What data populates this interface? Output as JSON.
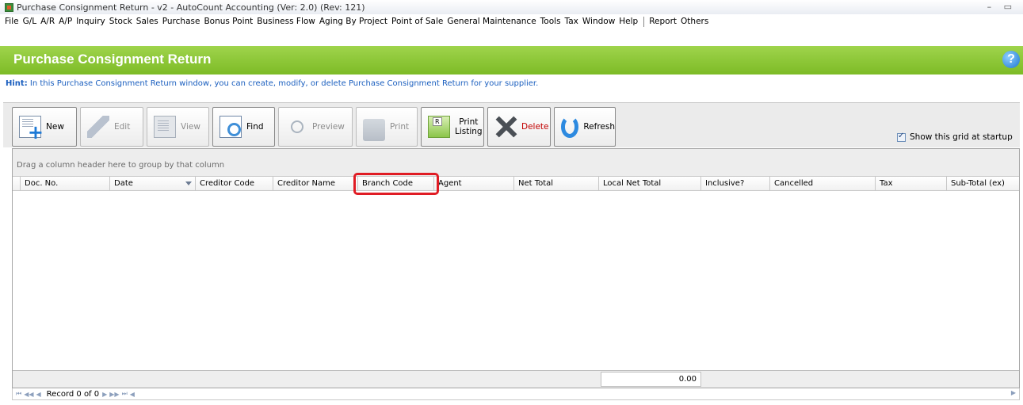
{
  "window": {
    "title": "Purchase Consignment Return - v2 - AutoCount Accounting (Ver: 2.0) (Rev: 121)",
    "controls": "– ▭"
  },
  "menu": {
    "items": [
      "File",
      "G/L",
      "A/R",
      "A/P",
      "Inquiry",
      "Stock",
      "Sales",
      "Purchase",
      "Bonus Point",
      "Business Flow",
      "Aging By Project",
      "Point of Sale",
      "General Maintenance",
      "Tools",
      "Tax",
      "Window",
      "Help"
    ],
    "extra": [
      "Report",
      "Others"
    ]
  },
  "header": {
    "title": "Purchase Consignment Return",
    "help": "?"
  },
  "hint": {
    "label": "Hint:",
    "text": " In this Purchase Consignment Return window, you can create, modify, or delete Purchase Consignment Return for your supplier."
  },
  "toolbar": {
    "new": "New",
    "edit": "Edit",
    "view": "View",
    "find": "Find",
    "preview": "Preview",
    "print": "Print",
    "print_listing_1": "Print",
    "print_listing_2": "Listing",
    "delete": "Delete",
    "refresh": "Refresh",
    "show_grid": "Show this grid at startup"
  },
  "grid": {
    "group_hint": "Drag a column header here to group by that column",
    "columns": [
      "Doc. No.",
      "Date",
      "Creditor Code",
      "Creditor Name",
      "Branch Code",
      "Agent",
      "Net Total",
      "Local Net Total",
      "Inclusive?",
      "Cancelled",
      "Tax",
      "Sub-Total (ex)"
    ],
    "footer_total": "0.00"
  },
  "nav": {
    "first": "⏮",
    "prev_page": "◀◀",
    "prev": "◀",
    "record": "Record 0 of 0",
    "next": "▶",
    "next_page": "▶▶",
    "last": "⏭",
    "scroll_left": "◀",
    "scroll_right": "▶"
  },
  "colors": {
    "header_green": "#8cc63f",
    "hint_blue": "#1b5fbf",
    "highlight_red": "#e01c24",
    "delete_red": "#c20000"
  }
}
